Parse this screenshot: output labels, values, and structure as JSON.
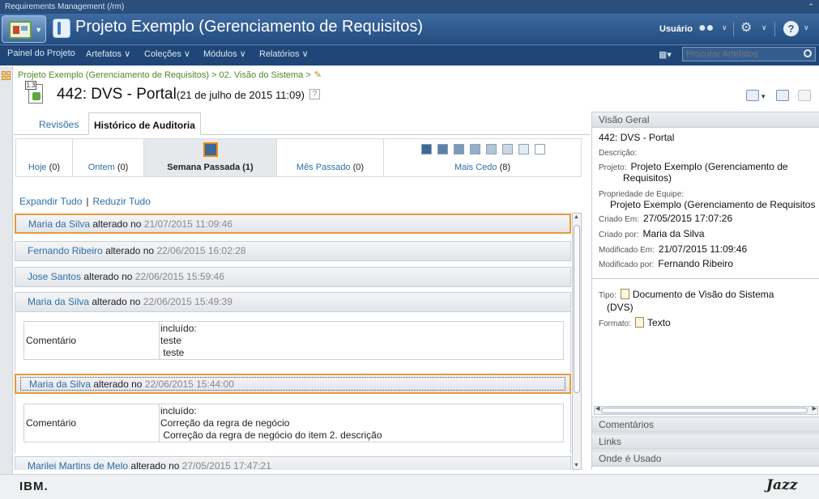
{
  "window": {
    "title": "Requirements Management (/rm)"
  },
  "header": {
    "project_title": "Projeto Exemplo (Gerenciamento de Requisitos)",
    "user_label": "Usuário"
  },
  "nav": {
    "items": [
      {
        "label": "Painel do Projeto"
      },
      {
        "label": "Artefatos ∨"
      },
      {
        "label": "Coleções ∨"
      },
      {
        "label": "Módulos ∨"
      },
      {
        "label": "Relatórios ∨"
      }
    ],
    "search_placeholder": "Procurar Artefatos"
  },
  "breadcrumb": "Projeto Exemplo (Gerenciamento de Requisitos) > 02. Visão do Sistema >",
  "artifact": {
    "icon_number": "1.3",
    "id_title": "442: DVS - Portal",
    "date": "(21 de julho de 2015 11:09)",
    "help": "?"
  },
  "tabs": [
    {
      "label": "Revisões",
      "active": false
    },
    {
      "label": "Histórico de Auditoria",
      "active": true
    }
  ],
  "time_filter": [
    {
      "label": "Hoje",
      "count": "(0)",
      "active": false
    },
    {
      "label": "Ontem",
      "count": "(0)",
      "active": false
    },
    {
      "label": "Semana Passada",
      "count": "(1)",
      "active": true
    },
    {
      "label": "Mês Passado",
      "count": "(0)",
      "active": false
    },
    {
      "label": "Mais Cedo",
      "count": "(8)",
      "active": false
    }
  ],
  "colors": {
    "accent": "#2f6fa8",
    "highlight": "#e79a3c",
    "squares": [
      "#3d6897",
      "#5a81ab",
      "#7a98bb",
      "#97b0ca",
      "#b3c5d8",
      "#ccd8e5",
      "#e3eaf1",
      "#ffffff"
    ]
  },
  "expand_all": "Expandir Tudo",
  "collapse_all": "Reduzir Tudo",
  "audit": {
    "verb": "alterado no",
    "entries": [
      {
        "user": "Maria da Silva",
        "ts": "21/07/2015 11:09:46"
      },
      {
        "user": "Fernando Ribeiro",
        "ts": "22/06/2015 16:02:28"
      },
      {
        "user": "Jose Santos",
        "ts": "22/06/2015 15:59:46"
      },
      {
        "user": "Maria da Silva",
        "ts": "22/06/2015 15:49:39"
      },
      {
        "user": "Maria da Silva",
        "ts": "22/06/2015 15:44:00"
      },
      {
        "user": "Marilei Martins de Melo",
        "ts": "27/05/2015 17:47:21"
      }
    ],
    "details": [
      {
        "key": "Comentário",
        "line1": "incluído:",
        "line2": "teste",
        "line3": " teste"
      },
      {
        "key": "Comentário",
        "line1": "incluído:",
        "line2": "Correção da regra de negócio",
        "line3": " Correção da regra de negócio do item 2. descrição"
      }
    ]
  },
  "overview": {
    "header": "Visão Geral",
    "name": "442: DVS - Portal",
    "description_label": "Descrição:",
    "project_label": "Projeto:",
    "project_value": "Projeto Exemplo (Gerenciamento de",
    "project_value2": "Requisitos)",
    "team_label": "Propriedade de Equipe:",
    "team_value": "Projeto Exemplo (Gerenciamento de Requisitos",
    "created_label": "Criado Em:",
    "created_value": "27/05/2015 17:07:26",
    "created_by_label": "Criado por:",
    "created_by_value": "Maria da Silva",
    "modified_label": "Modificado Em:",
    "modified_value": "21/07/2015 11:09:46",
    "modified_by_label": "Modificado por:",
    "modified_by_value": "Fernando Ribeiro",
    "type_label": "Tipo:",
    "type_value": "Documento de Visão do Sistema",
    "type_value2": "(DVS)",
    "format_label": "Formato:",
    "format_value": "Texto"
  },
  "right_sections": [
    {
      "label": "Comentários"
    },
    {
      "label": "Links"
    },
    {
      "label": "Onde é Usado"
    }
  ],
  "footer": {
    "left_logo": "IBM.",
    "right_logo": "Jazz"
  }
}
